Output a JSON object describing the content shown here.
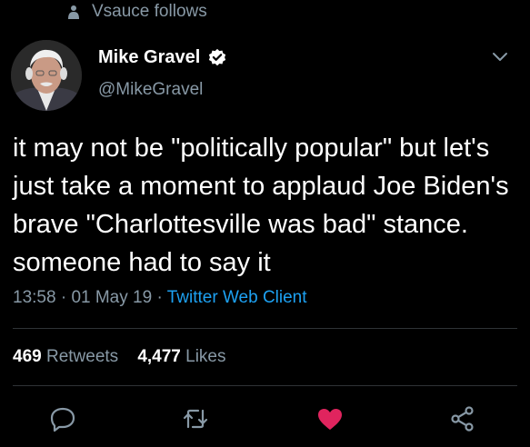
{
  "social_context": {
    "text": "Vsauce follows",
    "icon": "person-icon"
  },
  "author": {
    "display_name": "Mike Gravel",
    "handle": "@MikeGravel",
    "verified_icon": "verified-badge-icon"
  },
  "tweet": {
    "text": "it may not be \"politically popular\" but let's just take a moment to applaud Joe Biden's brave \"Charlottesville was bad\" stance. someone had to say it",
    "time": "13:58",
    "date": "01 May 19",
    "separator": " · ",
    "client": "Twitter Web Client"
  },
  "stats": {
    "retweets_count": "469",
    "retweets_label": "Retweets",
    "likes_count": "4,477",
    "likes_label": "Likes"
  },
  "actions": {
    "reply": "reply-icon",
    "retweet": "retweet-icon",
    "like": "heart-icon",
    "share": "share-icon"
  },
  "colors": {
    "background": "#000000",
    "secondary_text": "#8899a6",
    "link": "#1da1f2",
    "verified": "#1da1f2",
    "like_active": "#e0245e",
    "divider": "#2f3336"
  }
}
